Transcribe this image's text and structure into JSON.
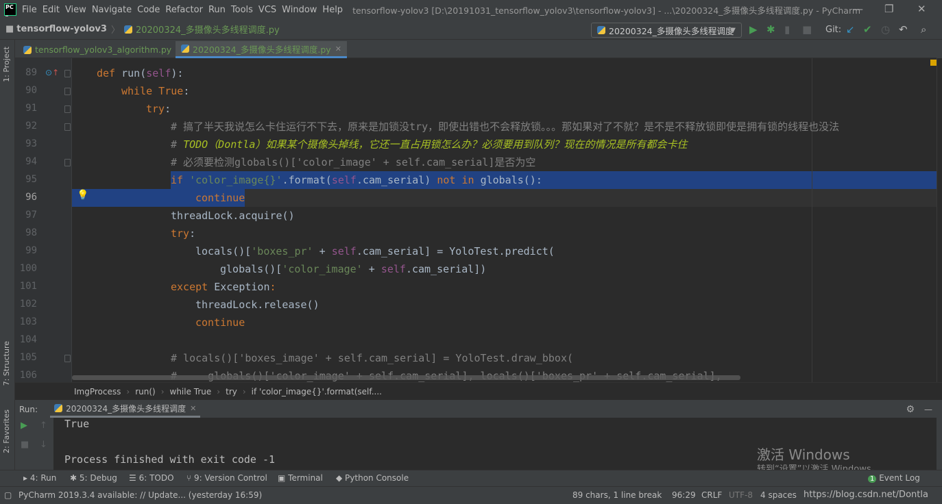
{
  "window": {
    "title": "tensorflow-yolov3 [D:\\20191031_tensorflow_yolov3\\tensorflow-yolov3] - ...\\20200324_多摄像头多线程调度.py - PyCharm",
    "logo": "PC"
  },
  "menu": [
    "File",
    "Edit",
    "View",
    "Navigate",
    "Code",
    "Refactor",
    "Run",
    "Tools",
    "VCS",
    "Window",
    "Help"
  ],
  "nav": {
    "project": "tensorflow-yolov3",
    "file": "20200324_多摄像头多线程调度.py",
    "run_config": "20200324_多摄像头多线程调度",
    "git_label": "Git:"
  },
  "tabs": [
    {
      "label": "tensorflow_yolov3_algorithm.py",
      "active": false
    },
    {
      "label": "20200324_多摄像头多线程调度.py",
      "active": true
    }
  ],
  "side": {
    "project": "1: Project",
    "structure": "7: Structure",
    "favorites": "2: Favorites"
  },
  "code": [
    {
      "n": "89",
      "indent": 0,
      "tokens": [
        [
          "k",
          "def "
        ],
        [
          "",
          "run("
        ],
        [
          "sf",
          "self"
        ],
        [
          "",
          "):"
        ]
      ]
    },
    {
      "n": "90",
      "indent": 1,
      "tokens": [
        [
          "k",
          "while True"
        ],
        [
          "",
          ":"
        ]
      ]
    },
    {
      "n": "91",
      "indent": 2,
      "tokens": [
        [
          "k",
          "try"
        ],
        [
          "",
          ":"
        ]
      ]
    },
    {
      "n": "92",
      "indent": 3,
      "tokens": [
        [
          "c",
          "# 搞了半天我说怎么卡住运行不下去，原来是加锁没try，即使出错也不会释放锁。。。那如果对了不就？是不是不释放锁即使是拥有锁的线程也没法"
        ]
      ]
    },
    {
      "n": "93",
      "indent": 3,
      "tokens": [
        [
          "c",
          "# "
        ],
        [
          "td",
          "TODO（Dontla）如果某个摄像头掉线，它还一直占用锁怎么办？必须要用到队列？现在的情况是所有都会卡住"
        ]
      ]
    },
    {
      "n": "94",
      "indent": 3,
      "tokens": [
        [
          "c",
          "# 必须要检测globals()['color_image' + self.cam_serial]是否为空"
        ]
      ]
    },
    {
      "n": "95",
      "indent": 3,
      "tokens": [
        [
          "k",
          "if "
        ],
        [
          "s",
          "'color_image{}'"
        ],
        [
          "",
          ".format("
        ],
        [
          "sf",
          "self"
        ],
        [
          "",
          ".cam_serial) "
        ],
        [
          "k",
          "not in "
        ],
        [
          "",
          "globals():"
        ]
      ]
    },
    {
      "n": "96",
      "indent": 4,
      "tokens": [
        [
          "k",
          "continue"
        ]
      ]
    },
    {
      "n": "97",
      "indent": 3,
      "tokens": [
        [
          "",
          "threadLock.acquire()"
        ]
      ]
    },
    {
      "n": "98",
      "indent": 3,
      "tokens": [
        [
          "k",
          "try"
        ],
        [
          "",
          ":"
        ]
      ]
    },
    {
      "n": "99",
      "indent": 4,
      "tokens": [
        [
          "",
          "locals()["
        ],
        [
          "s",
          "'boxes_pr'"
        ],
        [
          "",
          " + "
        ],
        [
          "sf",
          "self"
        ],
        [
          "",
          ".cam_serial] = YoloTest.predict("
        ]
      ]
    },
    {
      "n": "100",
      "indent": 5,
      "tokens": [
        [
          "",
          "globals()["
        ],
        [
          "s",
          "'color_image'"
        ],
        [
          "",
          " + "
        ],
        [
          "sf",
          "self"
        ],
        [
          "",
          ".cam_serial])"
        ]
      ]
    },
    {
      "n": "101",
      "indent": 3,
      "tokens": [
        [
          "k",
          "except "
        ],
        [
          "",
          "Exception"
        ],
        [
          "k",
          ":"
        ]
      ]
    },
    {
      "n": "102",
      "indent": 4,
      "tokens": [
        [
          "",
          "threadLock.release()"
        ]
      ]
    },
    {
      "n": "103",
      "indent": 4,
      "tokens": [
        [
          "k",
          "continue"
        ]
      ]
    },
    {
      "n": "104",
      "indent": 0,
      "tokens": []
    },
    {
      "n": "105",
      "indent": 3,
      "tokens": [
        [
          "c",
          "# locals()['boxes_image' + self.cam_serial] = YoloTest.draw_bbox("
        ]
      ]
    },
    {
      "n": "106",
      "indent": 3,
      "tokens": [
        [
          "c",
          "#     globals()['color_image' + self.cam_serial], locals()['boxes_pr' + self.cam_serial],"
        ]
      ]
    }
  ],
  "breadcrumb": [
    "ImgProcess",
    "run()",
    "while True",
    "try",
    "if 'color_image{}'.format(self...."
  ],
  "run": {
    "label": "Run:",
    "tab": "20200324_多摄像头多线程调度",
    "output": [
      "True",
      "",
      "Process finished with exit code -1"
    ]
  },
  "toolwindows": [
    "4: Run",
    "5: Debug",
    "6: TODO",
    "9: Version Control",
    "Terminal",
    "Python Console",
    "Event Log"
  ],
  "event_count": "1",
  "status": {
    "message": "PyCharm 2019.3.4 available: // Update... (yesterday 16:59)",
    "chars": "89 chars, 1 line break",
    "position": "96:29",
    "line_sep": "CRLF",
    "encoding": "UTF-8",
    "indent": "4 spaces",
    "url": "https://blog.csdn.net/Dontla"
  },
  "watermark": {
    "line1": "激活 Windows",
    "line2": "转到“设置”以激活 Windows。"
  },
  "colors": {
    "keyword": "#cc7832",
    "string": "#6a8759",
    "self": "#94558d",
    "comment": "#808080",
    "todo": "#a8c023",
    "selection": "#214283"
  }
}
